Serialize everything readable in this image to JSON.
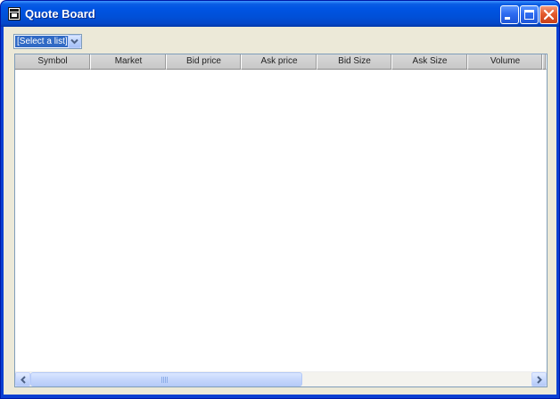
{
  "window": {
    "title": "Quote Board",
    "controls": [
      "minimize-icon",
      "maximize-icon",
      "close-icon"
    ],
    "colors": {
      "titlebar": "#0054e3",
      "close_button": "#e35a2d",
      "client_background": "#ece9d8",
      "selection": "#316ac5"
    }
  },
  "toolbar": {
    "list_select_value": "[Select a list]"
  },
  "grid": {
    "columns": [
      "Symbol",
      "Market",
      "Bid price",
      "Ask price",
      "Bid Size",
      "Ask Size",
      "Volume"
    ],
    "rows": []
  }
}
